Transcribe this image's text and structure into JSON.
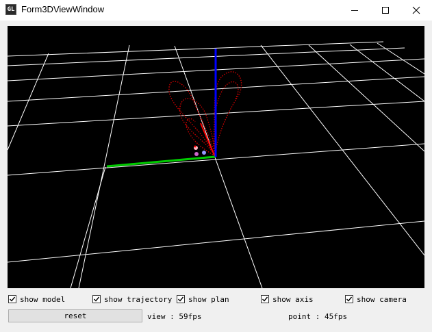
{
  "window": {
    "title": "Form3DViewWindow",
    "icon_text": "GL",
    "controls": [
      "minimize-icon",
      "maximize-icon",
      "close-icon"
    ]
  },
  "viewport": {
    "background": "#000000",
    "grid_color": "#ffffff",
    "axis_colors": {
      "x": "#ff0000",
      "y": "#00cc00",
      "z": "#0000ff"
    },
    "trajectory_color": "#cc0000"
  },
  "options": {
    "show_model": {
      "label": "show model",
      "checked": true
    },
    "show_trajectory": {
      "label": "show trajectory",
      "checked": true
    },
    "show_plan": {
      "label": "show plan",
      "checked": true
    },
    "show_axis": {
      "label": "show axis",
      "checked": true
    },
    "show_camera": {
      "label": "show camera",
      "checked": true
    }
  },
  "reset_label": "reset",
  "stats": {
    "view": "view : 59fps",
    "point": "point : 45fps"
  }
}
